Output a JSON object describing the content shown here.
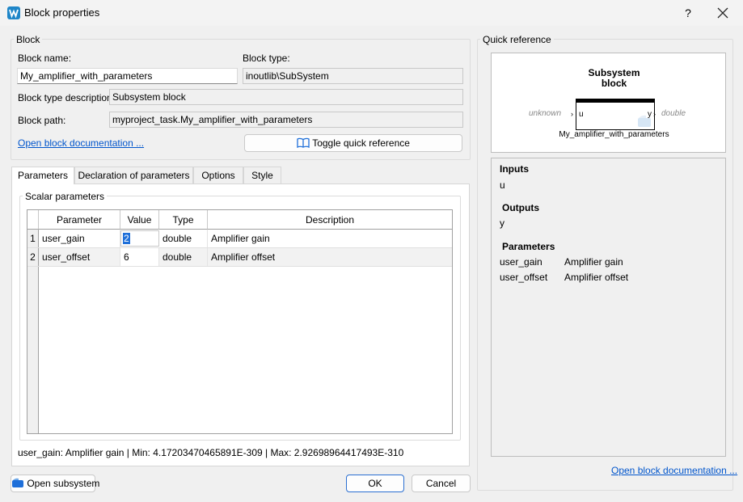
{
  "window": {
    "title": "Block properties",
    "help": "?",
    "close": "✕"
  },
  "block_group": {
    "title": "Block",
    "name_label": "Block name:",
    "name_value": "My_amplifier_with_parameters",
    "type_label": "Block type:",
    "type_value": "inoutlib\\SubSystem",
    "desc_label": "Block type description:",
    "desc_value": "Subsystem block",
    "path_label": "Block path:",
    "path_value": "myproject_task.My_amplifier_with_parameters",
    "doc_link": "Open block documentation ...",
    "toggle_button": "Toggle quick reference"
  },
  "tabs": [
    {
      "label": "Parameters",
      "active": true
    },
    {
      "label": "Declaration of parameters"
    },
    {
      "label": "Options"
    },
    {
      "label": "Style"
    }
  ],
  "scalar_params": {
    "title": "Scalar parameters",
    "headers": [
      "Parameter",
      "Value",
      "Type",
      "Description"
    ],
    "rows": [
      {
        "num": "1",
        "parameter": "user_gain",
        "value": "2",
        "type": "double",
        "description": "Amplifier gain"
      },
      {
        "num": "2",
        "parameter": "user_offset",
        "value": "6",
        "type": "double",
        "description": "Amplifier offset"
      }
    ]
  },
  "status_line": "user_gain: Amplifier gain | Min: 4.17203470465891E-309 | Max: 2.92698964417493E-310",
  "buttons": {
    "open_subsystem": "Open subsystem",
    "ok": "OK",
    "cancel": "Cancel"
  },
  "quick_ref": {
    "title": "Quick reference",
    "block_title_1": "Subsystem",
    "block_title_2": "block",
    "in_type": "unknown",
    "out_type": "double",
    "port_in": "u",
    "port_out": "y",
    "block_name": "My_amplifier_with_parameters",
    "inputs_head": "Inputs",
    "inputs": "u",
    "outputs_head": "Outputs",
    "outputs": "y",
    "params_head": "Parameters",
    "params": [
      {
        "name": "user_gain",
        "desc": "Amplifier gain"
      },
      {
        "name": "user_offset",
        "desc": "Amplifier offset"
      }
    ],
    "doc_link": "Open block documentation ..."
  },
  "colors": {
    "accent": "#1e6fd9",
    "link": "#0055cc",
    "app_icon": "#1f86c8"
  }
}
